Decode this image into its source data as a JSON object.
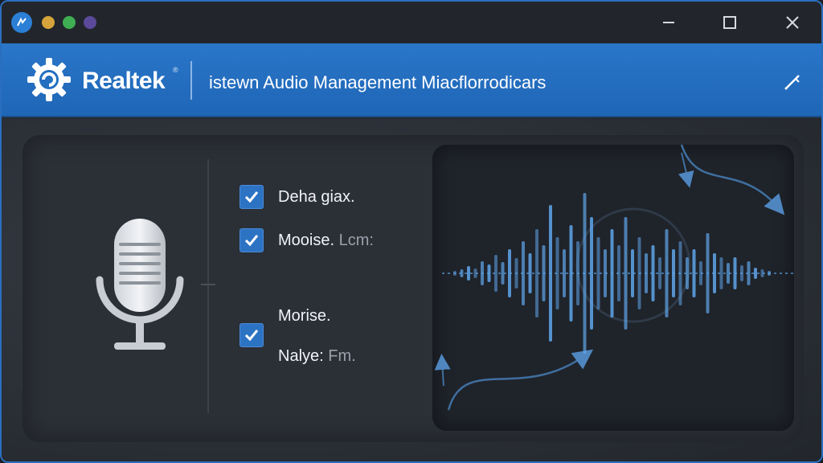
{
  "window": {
    "icon": "app-badge-icon",
    "controls": {
      "minimize": "minimize-icon",
      "maximize": "maximize-icon",
      "close": "close-icon"
    }
  },
  "header": {
    "brand": "Realtek",
    "brand_mark": "®",
    "title": "istewn Audio Management Miacflorrodicars",
    "tool_icon": "pen-icon"
  },
  "options": [
    {
      "label": "Deha giax.",
      "sub": "",
      "checked": true
    },
    {
      "label": "Mooise.",
      "sub": "Lcm:",
      "checked": true
    },
    {
      "label": "Morise.",
      "sub": "",
      "checked": true
    },
    {
      "label": "Nalye:",
      "sub": "Fm.",
      "checked": false
    }
  ],
  "colors": {
    "accent": "#2a76c9",
    "checkbox": "#2d73c4",
    "wave": "#5fa6ea"
  }
}
